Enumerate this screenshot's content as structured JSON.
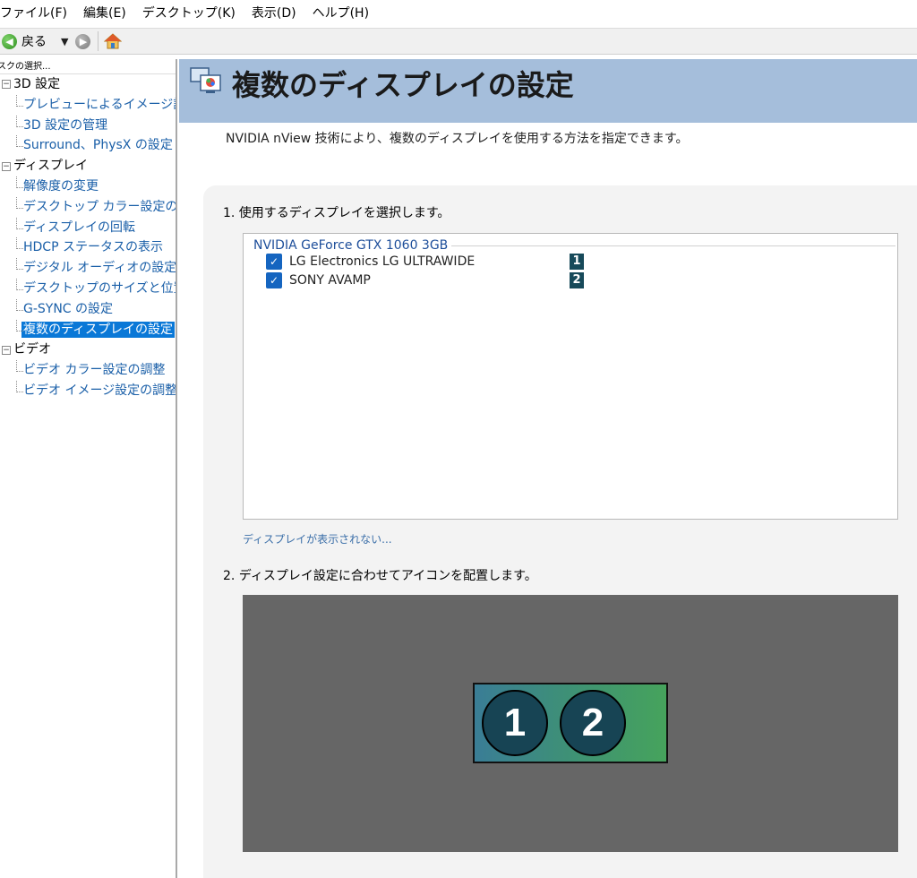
{
  "menubar": {
    "items": [
      "ファイル(F)",
      "編集(E)",
      "デスクトップ(K)",
      "表示(D)",
      "ヘルプ(H)"
    ]
  },
  "toolbar": {
    "back_label": "戻る",
    "back_icon": "back-arrow-icon",
    "forward_icon": "forward-arrow-icon",
    "home_icon": "home-icon"
  },
  "sidebar": {
    "header": "スクの選択...",
    "categories": [
      {
        "label": "3D 設定",
        "items": [
          "プレビューによるイメージ設",
          "3D 設定の管理",
          "Surround、PhysX の設定"
        ]
      },
      {
        "label": "ディスプレイ",
        "items": [
          "解像度の変更",
          "デスクトップ カラー設定の",
          "ディスプレイの回転",
          "HDCP ステータスの表示",
          "デジタル オーディオの設定",
          "デスクトップのサイズと位置",
          "G-SYNC の設定",
          "複数のディスプレイの設定"
        ],
        "selected": "複数のディスプレイの設定"
      },
      {
        "label": "ビデオ",
        "items": [
          "ビデオ カラー設定の調整",
          "ビデオ イメージ設定の調整"
        ]
      }
    ]
  },
  "main": {
    "title": "複数のディスプレイの設定",
    "intro": "NVIDIA nView 技術により、複数のディスプレイを使用する方法を指定できます。",
    "step1": "1. 使用するディスプレイを選択します。",
    "gpu_name": "NVIDIA GeForce GTX 1060 3GB",
    "displays": [
      {
        "name": "LG Electronics LG ULTRAWIDE",
        "number": "1",
        "checked": true
      },
      {
        "name": "SONY AVAMP",
        "number": "2",
        "checked": true
      }
    ],
    "missing_link": "ディスプレイが表示されない...",
    "step2": "2. ディスプレイ設定に合わせてアイコンを配置します。",
    "arrangement": [
      "1",
      "2"
    ]
  },
  "colors": {
    "banner": "#a5bedb",
    "selection": "#0a78d7",
    "link": "#1a5fa8",
    "badge": "#174a5a",
    "arrange_bg": "#666666"
  }
}
